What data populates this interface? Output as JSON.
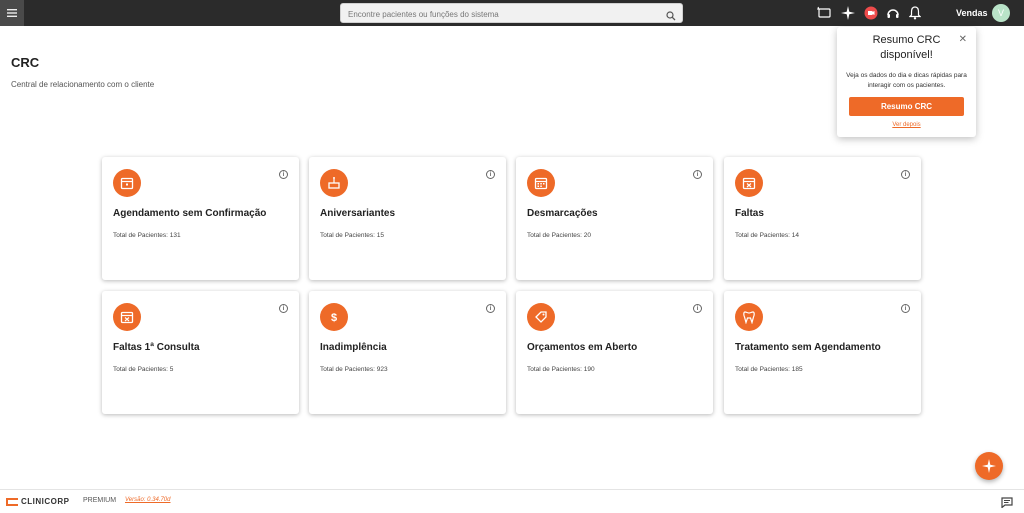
{
  "header": {
    "search_placeholder": "Encontre pacientes ou funções do sistema",
    "user_name": "Vendas",
    "avatar_initial": "V"
  },
  "page": {
    "title": "CRC",
    "subtitle": "Central de relacionamento com o cliente"
  },
  "cards": [
    {
      "title": "Agendamento sem Confirmação",
      "total": "Total de Pacientes: 131",
      "icon": "calendar-icon"
    },
    {
      "title": "Aniversariantes",
      "total": "Total de Pacientes: 15",
      "icon": "cake-icon"
    },
    {
      "title": "Desmarcações",
      "total": "Total de Pacientes: 20",
      "icon": "calendar-grid-icon"
    },
    {
      "title": "Faltas",
      "total": "Total de Pacientes: 14",
      "icon": "calendar-x-icon"
    },
    {
      "title": "Faltas 1ª Consulta",
      "total": "Total de Pacientes: 5",
      "icon": "calendar-x-icon"
    },
    {
      "title": "Inadimplência",
      "total": "Total de Pacientes: 923",
      "icon": "dollar-icon"
    },
    {
      "title": "Orçamentos em Aberto",
      "total": "Total de Pacientes: 190",
      "icon": "tag-icon"
    },
    {
      "title": "Tratamento sem Agendamento",
      "total": "Total de Pacientes: 185",
      "icon": "tooth-icon"
    }
  ],
  "popup": {
    "title": "Resumo CRC disponível!",
    "text": "Veja os dados do dia e dicas rápidas para interagir com os pacientes.",
    "button_label": "Resumo CRC",
    "link_label": "Ver depois",
    "close_label": "✕"
  },
  "footer": {
    "brand": "CLINICORP",
    "plan": "PREMIUM",
    "version": "Versão: 0.34.70d"
  },
  "colors": {
    "accent": "#ee6a28",
    "topbar": "#2b2b2b"
  }
}
